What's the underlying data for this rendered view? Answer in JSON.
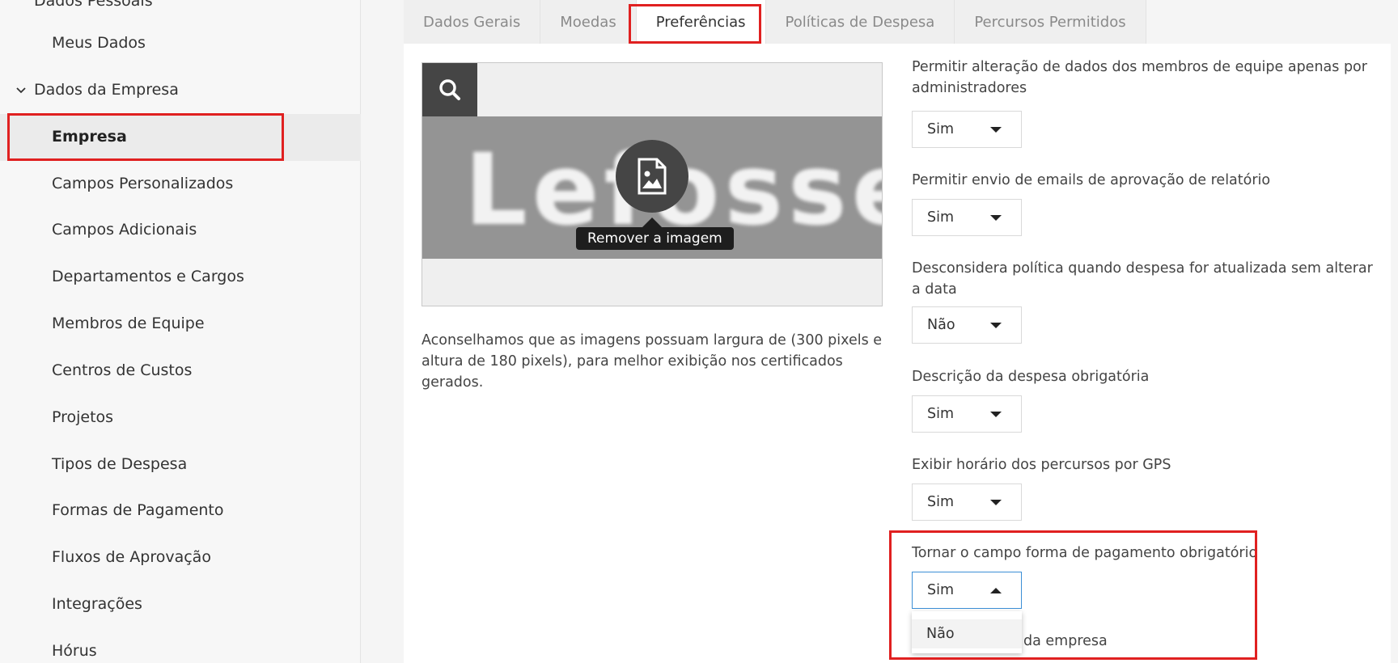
{
  "sidebar": {
    "top_cut_label": "Dados Pessoais",
    "meus_dados": "Meus Dados",
    "group_empresa": "Dados da Empresa",
    "items": [
      "Empresa",
      "Campos Personalizados",
      "Campos Adicionais",
      "Departamentos e Cargos",
      "Membros de Equipe",
      "Centros de Custos",
      "Projetos",
      "Tipos de Despesa",
      "Formas de Pagamento",
      "Fluxos de Aprovação",
      "Integrações",
      "Hórus"
    ],
    "active_item": "Empresa"
  },
  "tabs": [
    "Dados Gerais",
    "Moedas",
    "Preferências",
    "Políticas de Despesa",
    "Percursos Permitidos"
  ],
  "active_tab": "Preferências",
  "logo": {
    "text": "Lefosse",
    "tooltip": "Remover a imagem",
    "hint": "Aconselhamos que as imagens possuam largura de (300 pixels e altura de 180 pixels), para melhor exibição nos certificados gerados."
  },
  "settings": [
    {
      "label": "Permitir alteração de dados dos membros de equipe apenas por administradores",
      "value": "Sim"
    },
    {
      "label": "Permitir envio de emails de aprovação de relatório",
      "value": "Sim"
    },
    {
      "label": "Desconsidera política quando despesa for atualizada sem alterar a data",
      "value": "Não"
    },
    {
      "label": "Descrição da despesa obrigatória",
      "value": "Sim"
    },
    {
      "label": "Exibir horário dos percursos por GPS",
      "value": "Sim"
    },
    {
      "label": "Tornar o campo forma de pagamento obrigatório",
      "value": "Sim"
    }
  ],
  "open_dropdown": {
    "options": [
      "Não"
    ]
  },
  "cut_label": "da empresa",
  "colors": {
    "highlight": "#e02020",
    "focus": "#3c8fd6"
  }
}
